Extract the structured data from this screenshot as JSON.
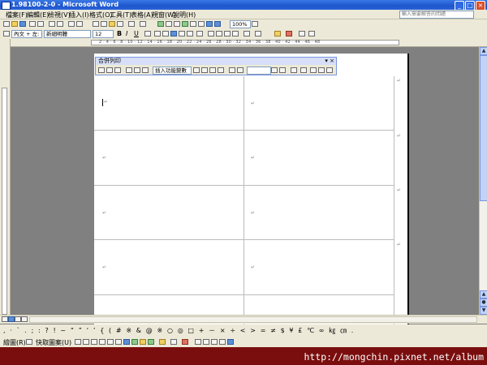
{
  "window": {
    "title": "1.98100-2-0 - Microsoft Word",
    "buttons": [
      "_",
      "□",
      "×"
    ]
  },
  "menu": {
    "items": [
      "檔案(F)",
      "編輯(E)",
      "檢視(V)",
      "插入(I)",
      "格式(O)",
      "工具(T)",
      "表格(A)",
      "視窗(W)",
      "說明(H)"
    ],
    "help_placeholder": "輸入需要解答的問題"
  },
  "format_toolbar": {
    "style": "內文 + 左: 0",
    "font": "新細明體",
    "size": "12",
    "bold": "B",
    "italic": "I",
    "underline": "U"
  },
  "standard_toolbar": {
    "zoom": "100%"
  },
  "ruler": {
    "numbers": "2 · 4 · 6 · 8 · 10 · 12 · 14 · 16 · 18 · 20 · 22 · 24 · 26 · 28 · 30 · 32 · 34 · 36 · 38 · 40 · 42 · 44 · 46 · 48"
  },
  "mail_merge": {
    "title": "合併列印",
    "insert_fields": "插入功能變數"
  },
  "document": {
    "paragraph_mark": "↵"
  },
  "symbol_toolbar": {
    "symbols": ", · ˋ . ; : ? ! ~ “ ” ‘ ’ { ( # ※ & @ ※ ○ ◎ □ + － × ÷ < > = ≠ $ ¥ £ ℃ ∞ ㎏ ㎝ ."
  },
  "draw_toolbar": {
    "draw_label": "繪圖(R)",
    "autoshapes_label": "快取圖案(U)"
  },
  "watermark": "http://mongchin.pixnet.net/album"
}
